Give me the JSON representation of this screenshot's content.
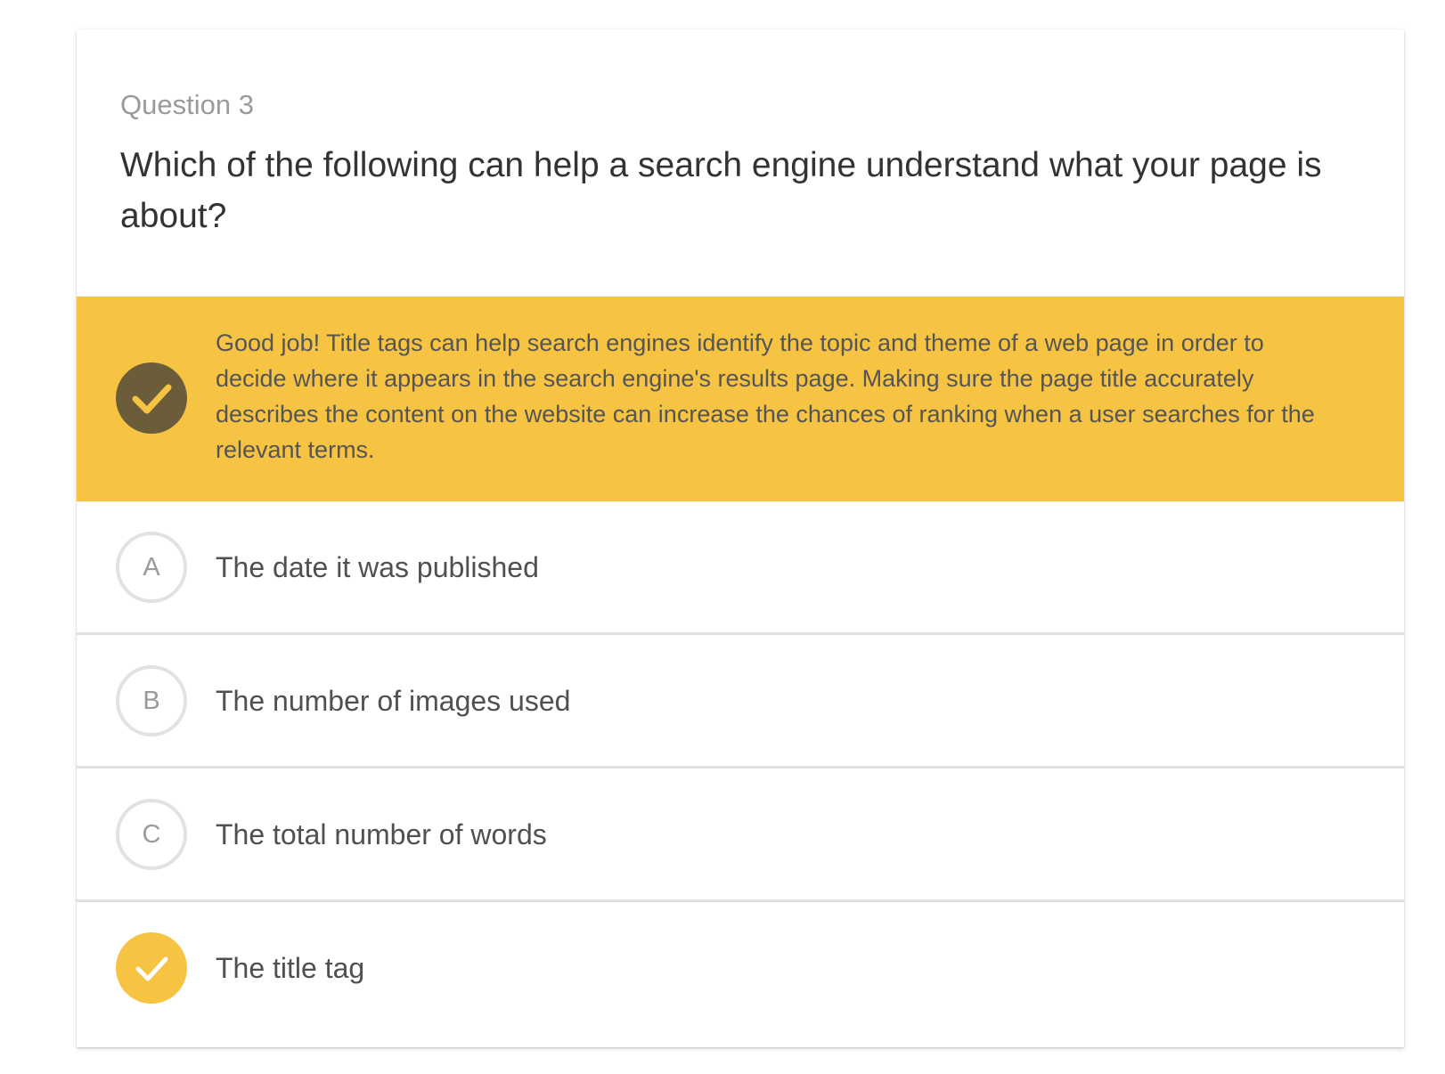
{
  "question": {
    "label": "Question 3",
    "text": "Which of the following can help a search engine understand what your page is about?"
  },
  "feedback": {
    "icon": "check-circle-icon",
    "text": "Good job! Title tags can help search engines identify the topic and theme of a web page in order to decide where it appears in the search engine's results page. Making sure the page title accurately describes the content on the website can increase the chances of ranking when a user searches for the relevant terms.",
    "background_color": "#f6c343",
    "icon_color": "#6b5c3a"
  },
  "options": [
    {
      "letter": "A",
      "text": "The date it was published",
      "selected": false
    },
    {
      "letter": "B",
      "text": "The number of images used",
      "selected": false
    },
    {
      "letter": "C",
      "text": "The total number of words",
      "selected": false
    },
    {
      "letter": "",
      "text": "The title tag",
      "selected": true,
      "icon": "check-icon"
    }
  ],
  "colors": {
    "accent": "#f6c343",
    "divider": "#e0e0e0"
  }
}
